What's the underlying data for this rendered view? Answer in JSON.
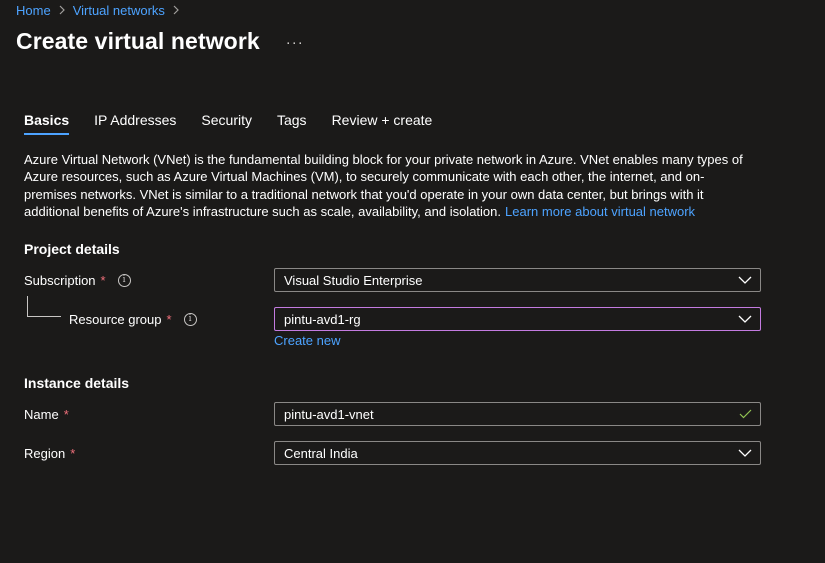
{
  "breadcrumb": {
    "items": [
      "Home",
      "Virtual networks"
    ]
  },
  "page": {
    "title": "Create virtual network",
    "more_label": "···"
  },
  "tabs": [
    {
      "label": "Basics",
      "active": true
    },
    {
      "label": "IP Addresses",
      "active": false
    },
    {
      "label": "Security",
      "active": false
    },
    {
      "label": "Tags",
      "active": false
    },
    {
      "label": "Review + create",
      "active": false
    }
  ],
  "description": {
    "text": "Azure Virtual Network (VNet) is the fundamental building block for your private network in Azure. VNet enables many types of Azure resources, such as Azure Virtual Machines (VM), to securely communicate with each other, the internet, and on-premises networks. VNet is similar to a traditional network that you'd operate in your own data center, but brings with it additional benefits of Azure's infrastructure such as scale, availability, and isolation.",
    "link": "Learn more about virtual network"
  },
  "project_details": {
    "title": "Project details",
    "subscription": {
      "label": "Subscription",
      "required": "*",
      "value": "Visual Studio Enterprise",
      "icon": "info-icon"
    },
    "resource_group": {
      "label": "Resource group",
      "required": "*",
      "value": "pintu-avd1-rg",
      "icon": "info-icon"
    },
    "create_new": "Create new"
  },
  "instance_details": {
    "title": "Instance details",
    "name": {
      "label": "Name",
      "required": "*",
      "value": "pintu-avd1-vnet",
      "icon": "checkmark-icon"
    },
    "region": {
      "label": "Region",
      "required": "*",
      "value": "Central India"
    }
  },
  "colors": {
    "background": "#1b1a19",
    "link": "#4da3ff",
    "required": "#f1707b",
    "focus_border": "#c37be0",
    "valid_check": "#92c353"
  }
}
